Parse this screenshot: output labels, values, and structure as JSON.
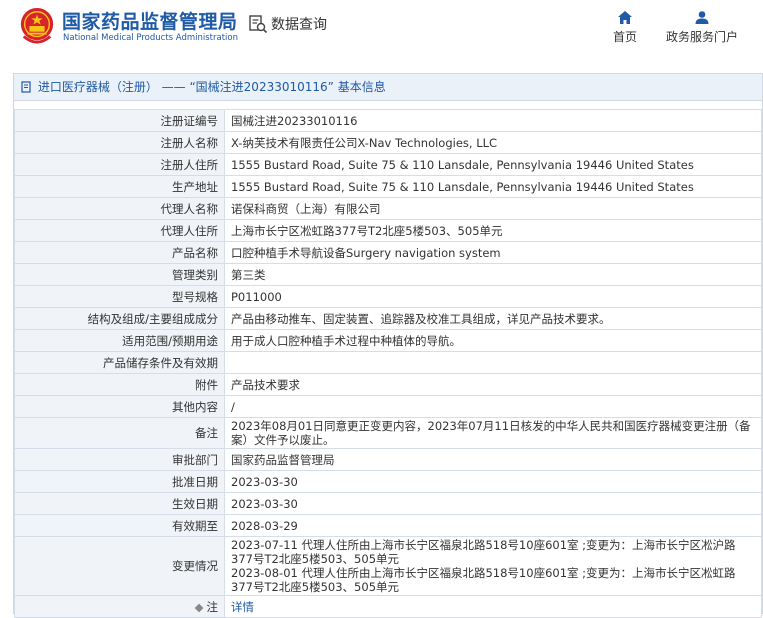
{
  "header": {
    "brand_cn": "国家药品监督管理局",
    "brand_en": "National Medical Products Administration",
    "query_label": "数据查询",
    "nav": [
      {
        "label": "首页",
        "icon": "home-icon"
      },
      {
        "label": "政务服务门户",
        "icon": "user-icon"
      }
    ]
  },
  "panel": {
    "title": "进口医疗器械（注册） —— “国械注进20233010116” 基本信息"
  },
  "details": [
    {
      "label": "注册证编号",
      "value": "国械注进20233010116"
    },
    {
      "label": "注册人名称",
      "value": "X-纳芙技术有限责任公司X-Nav Technologies, LLC"
    },
    {
      "label": "注册人住所",
      "value": "1555 Bustard Road, Suite 75 & 110 Lansdale, Pennsylvania 19446 United States"
    },
    {
      "label": "生产地址",
      "value": "1555 Bustard Road, Suite 75 & 110 Lansdale, Pennsylvania 19446 United States"
    },
    {
      "label": "代理人名称",
      "value": "诺保科商贸（上海）有限公司"
    },
    {
      "label": "代理人住所",
      "value": "上海市长宁区凇虹路377号T2北座5楼503、505单元"
    },
    {
      "label": "产品名称",
      "value": "口腔种植手术导航设备Surgery navigation system"
    },
    {
      "label": "管理类别",
      "value": "第三类"
    },
    {
      "label": "型号规格",
      "value": "P011000"
    },
    {
      "label": "结构及组成/主要组成成分",
      "value": "产品由移动推车、固定装置、追踪器及校准工具组成，详见产品技术要求。"
    },
    {
      "label": "适用范围/预期用途",
      "value": "用于成人口腔种植手术过程中种植体的导航。"
    },
    {
      "label": "产品储存条件及有效期",
      "value": ""
    },
    {
      "label": "附件",
      "value": "产品技术要求"
    },
    {
      "label": "其他内容",
      "value": "/"
    },
    {
      "label": "备注",
      "value": "2023年08月01日同意更正变更内容，2023年07月11日核发的中华人民共和国医疗器械变更注册（备案）文件予以废止。"
    },
    {
      "label": "审批部门",
      "value": "国家药品监督管理局"
    },
    {
      "label": "批准日期",
      "value": "2023-03-30"
    },
    {
      "label": "生效日期",
      "value": "2023-03-30"
    },
    {
      "label": "有效期至",
      "value": "2028-03-29"
    },
    {
      "label": "变更情况",
      "value_lines": [
        "2023-07-11 代理人住所由上海市长宁区福泉北路518号10座601室 ;变更为：上海市长宁区凇沪路377号T2北座5楼503、505单元",
        "2023-08-01 代理人住所由上海市长宁区福泉北路518号10座601室 ;变更为：上海市长宁区凇虹路377号T2北座5楼503、505单元"
      ]
    },
    {
      "label": "注",
      "link": "详情"
    }
  ]
}
